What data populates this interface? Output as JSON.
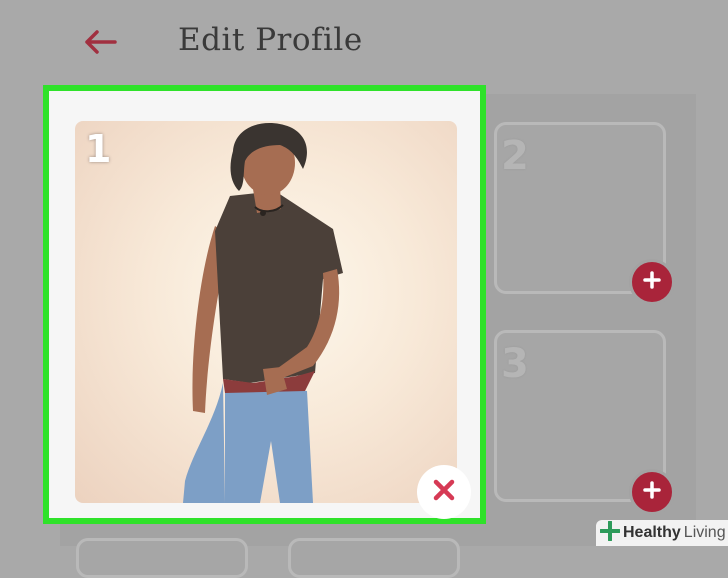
{
  "header": {
    "title": "Edit Profile",
    "back_icon": "arrow-left-icon"
  },
  "photos": [
    {
      "number": "1",
      "has_photo": true,
      "action_icon": "close-icon"
    },
    {
      "number": "2",
      "has_photo": false,
      "action_icon": "plus-icon"
    },
    {
      "number": "3",
      "has_photo": false,
      "action_icon": "plus-icon"
    }
  ],
  "watermark": {
    "brand_bold": "Healthy",
    "brand_light": "Living"
  },
  "colors": {
    "accent": "#a9243a",
    "remove_x": "#d63a55",
    "highlight": "#2fe22a",
    "background": "#a9a9a9"
  }
}
